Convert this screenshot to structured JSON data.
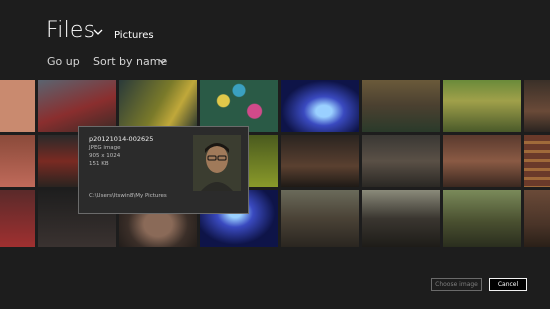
{
  "header": {
    "title": "Files",
    "location": "Pictures"
  },
  "toolbar": {
    "go_up_label": "Go up",
    "sort_label": "Sort by name"
  },
  "tooltip": {
    "file_name": "p20121014-002625",
    "file_type": "JPEG image",
    "dimensions": "905 x 1024",
    "file_size": "151 KB",
    "path": "C:\\Users\\ltswin8\\My Pictures"
  },
  "footer": {
    "choose_label": "Choose image",
    "cancel_label": "Cancel"
  },
  "thumbnails": [
    {
      "subject": "orange-flower",
      "color": "#c9826a"
    },
    {
      "subject": "red-sports-car",
      "color": "#7a2f2a"
    },
    {
      "subject": "yellow-car-person",
      "color": "#4f5a2a"
    },
    {
      "subject": "colorful-pattern",
      "color": "#2e5a4a"
    },
    {
      "subject": "blue-glow-curve",
      "color": "#1f2a7a"
    },
    {
      "subject": "group-outdoor",
      "color": "#5a4a32"
    },
    {
      "subject": "garden-path",
      "color": "#4a6a32"
    },
    {
      "subject": "two-people-selfie",
      "color": "#4a3a2a"
    },
    {
      "subject": "flowers-pink",
      "color": "#8a4a3a"
    },
    {
      "subject": "red-motorcycle",
      "color": "#6a2a22"
    },
    {
      "subject": "yellow-green",
      "color": "#6a7a22"
    },
    {
      "subject": "group-night",
      "color": "#3a2f28"
    },
    {
      "subject": "two-men-standing",
      "color": "#3e3a34"
    },
    {
      "subject": "woman-smiling",
      "color": "#5a3a2e"
    },
    {
      "subject": "bookshelf",
      "color": "#6a3a2a"
    },
    {
      "subject": "red-car",
      "color": "#7a2a2a"
    },
    {
      "subject": "dark-car-interior",
      "color": "#2a2a2a"
    },
    {
      "subject": "portrait-man",
      "color": "#4a3a2e"
    },
    {
      "subject": "blue-glow-curve-2",
      "color": "#1e2878"
    },
    {
      "subject": "group-of-people",
      "color": "#4a4236"
    },
    {
      "subject": "two-men-posing",
      "color": "#3a3630"
    },
    {
      "subject": "group-garden",
      "color": "#4a5030"
    },
    {
      "subject": "man-bookshelf",
      "color": "#4a3428"
    }
  ]
}
